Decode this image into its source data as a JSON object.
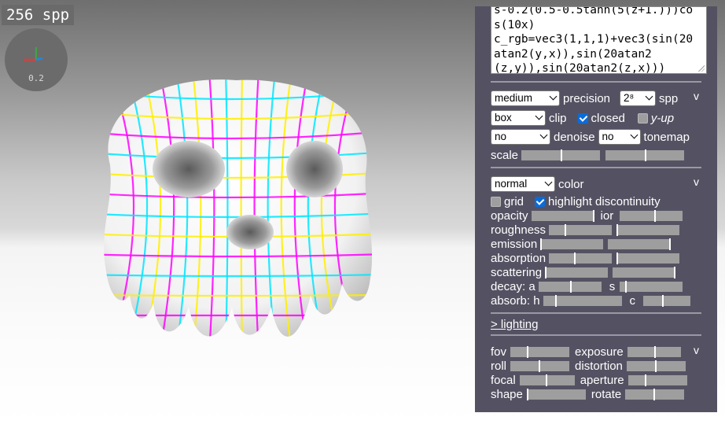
{
  "viewport": {
    "spp_counter": "256 spp",
    "axis_gizmo": {
      "tick_label": "0.2",
      "x_color": "#e53935",
      "y_color": "#43a047",
      "z_color": "#1e88e5"
    },
    "object_colors": [
      "#ff00ff",
      "#00e5ff",
      "#ffee00"
    ]
  },
  "panel": {
    "code_lines": [
      "s-0.2(0.5-0.5tanh(5(z+1.)))co",
      "s(10x)",
      "c_rgb=vec3(1,1,1)+vec3(sin(20",
      "atan2(y,x)),sin(20atan2",
      "(z,y)),sin(20atan2(z,x)))"
    ],
    "render": {
      "precision_value": "medium",
      "precision_label": "precision",
      "spp_value": "2⁸",
      "spp_label": "spp",
      "toggle": "v",
      "clip_value": "box",
      "clip_label": "clip",
      "closed_label": "closed",
      "closed_checked": true,
      "yup_label": "y-up",
      "yup_checked": false,
      "denoise_value": "no",
      "denoise_label": "denoise",
      "tonemap_value": "no",
      "tonemap_label": "tonemap",
      "scale_label": "scale",
      "scale_a": 0.5,
      "scale_b": 0.5
    },
    "color": {
      "mode_value": "normal",
      "mode_label": "color",
      "toggle": "v",
      "grid_label": "grid",
      "grid_checked": false,
      "highlight_label": "highlight discontinuity",
      "highlight_checked": true,
      "opacity_label": "opacity",
      "opacity": 0.98,
      "ior_label": "ior",
      "ior": 0.55,
      "roughness_label": "roughness",
      "roughness": 0.25,
      "roughness_b": 0.0,
      "emission_label": "emission",
      "emission": 0.0,
      "emission_b": 0.98,
      "absorption_label": "absorption",
      "absorption": 0.4,
      "absorption_b": 0.0,
      "scattering_label": "scattering",
      "scattering": 0.0,
      "scattering_b": 0.98,
      "decay_label": "decay: a",
      "decay_a": 0.5,
      "decay_s_label": "s",
      "decay_s": 0.08,
      "absorb_label": "absorb: h",
      "absorb_h": 0.15,
      "absorb_c_label": "c",
      "absorb_c": 0.4
    },
    "lighting_link": "> lighting",
    "camera": {
      "toggle": "v",
      "fov_label": "fov",
      "fov": 0.28,
      "exposure_label": "exposure",
      "exposure": 0.5,
      "roll_label": "roll",
      "roll": 0.48,
      "distortion_label": "distortion",
      "distortion": 0.48,
      "focal_label": "focal",
      "focal": 0.48,
      "aperture_label": "aperture",
      "aperture": 0.28,
      "shape_label": "shape",
      "shape": 0.0,
      "rotate_label": "rotate",
      "rotate": 0.48
    }
  }
}
